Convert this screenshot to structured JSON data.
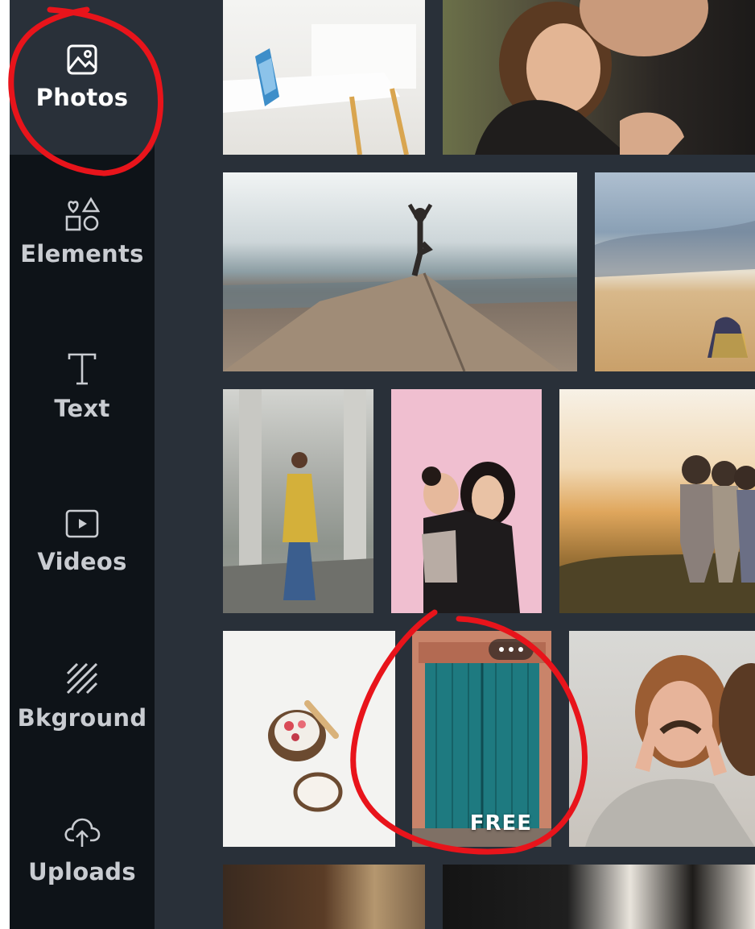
{
  "sidebar": {
    "items": [
      {
        "label": "Photos",
        "icon": "image-icon",
        "active": true
      },
      {
        "label": "Elements",
        "icon": "shapes-icon",
        "active": false
      },
      {
        "label": "Text",
        "icon": "text-icon",
        "active": false
      },
      {
        "label": "Videos",
        "icon": "video-play-icon",
        "active": false
      },
      {
        "label": "Bkground",
        "icon": "background-stripes-icon",
        "active": false
      },
      {
        "label": "Uploads",
        "icon": "cloud-upload-icon",
        "active": false
      }
    ]
  },
  "photo_grid": {
    "free_badge": "FREE",
    "more_icon": "more-dots-icon"
  },
  "colors": {
    "sidebar_bg": "#0e1318",
    "panel_bg": "#293039",
    "annotation": "#e8141b"
  }
}
